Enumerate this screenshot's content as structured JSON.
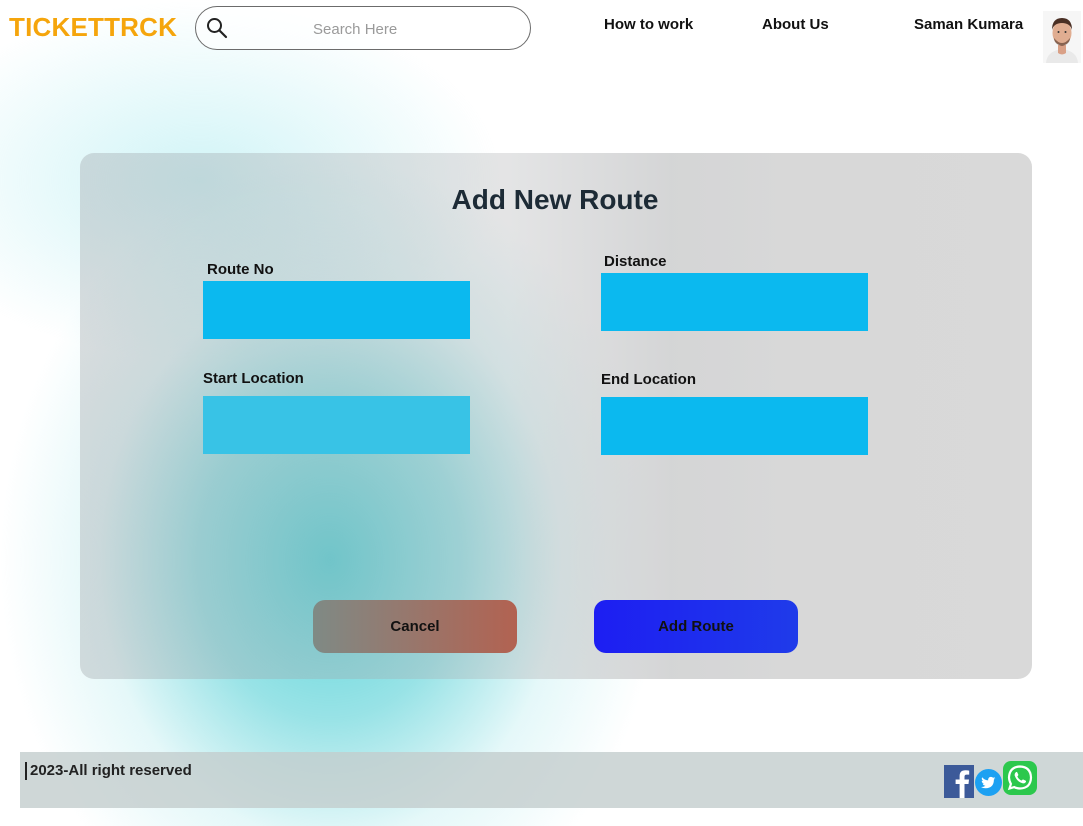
{
  "brand": {
    "name": "TICKETTRCK",
    "color": "#f5a50c"
  },
  "search": {
    "placeholder": "Search Here",
    "value": "",
    "icon": "search-icon"
  },
  "nav": {
    "how_to_work": "How to work",
    "about_us": "About Us",
    "user_name": "Saman Kumara",
    "avatar_icon": "user-avatar"
  },
  "form": {
    "title": "Add New Route",
    "fields": {
      "route_no": {
        "label": "Route No",
        "value": ""
      },
      "distance": {
        "label": "Distance",
        "value": ""
      },
      "start_location": {
        "label": "Start Location",
        "value": ""
      },
      "end_location": {
        "label": "End Location",
        "value": ""
      }
    },
    "cancel_label": "Cancel",
    "submit_label": "Add Route",
    "colors": {
      "input_bg": "#0bb9ef",
      "input_bg_alt": "#38c3e6",
      "cancel_gradient": [
        "#7f8a85",
        "#b26251"
      ],
      "submit_gradient": [
        "#1d1ef2",
        "#1f3bea"
      ]
    }
  },
  "footer": {
    "copyright": "2023-All right reserved",
    "social": [
      "facebook-icon",
      "twitter-icon",
      "whatsapp-icon"
    ],
    "colors": {
      "facebook": "#3c5a99",
      "twitter": "#1da1f2",
      "whatsapp": "#2cc84d"
    }
  }
}
